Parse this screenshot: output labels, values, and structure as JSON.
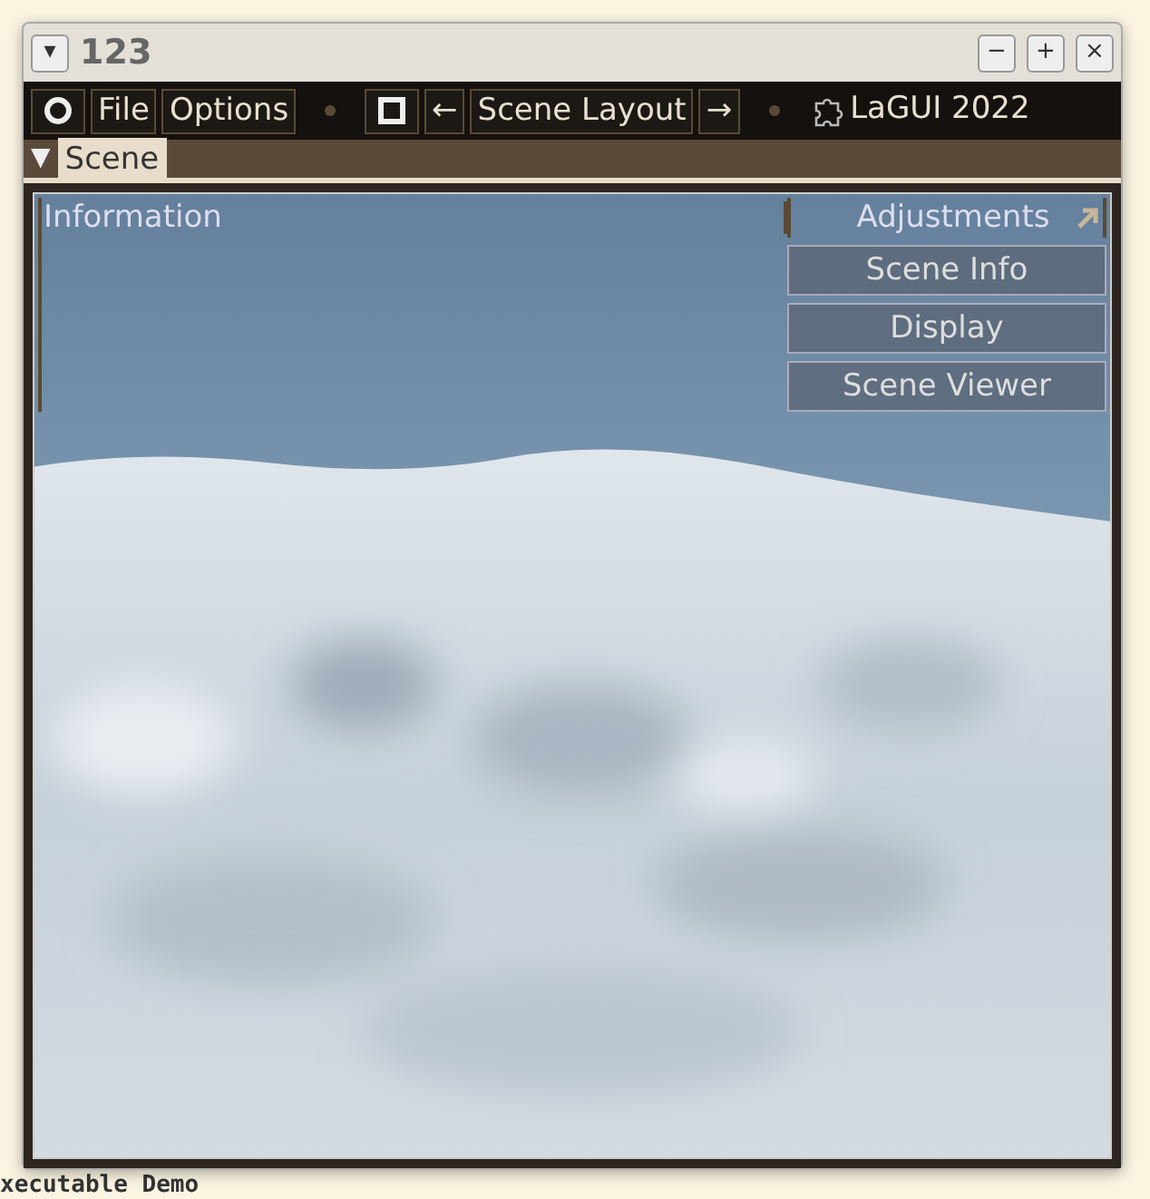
{
  "background_editor": {
    "status": "xecutable Demo"
  },
  "window": {
    "title": "123",
    "menu_glyph": "▾",
    "controls": [
      "−",
      "+",
      "×"
    ]
  },
  "toolbar": {
    "items": [
      {
        "kind": "circle"
      },
      {
        "kind": "text",
        "label": "File"
      },
      {
        "kind": "text",
        "label": "Options"
      },
      {
        "kind": "dot"
      },
      {
        "kind": "square"
      },
      {
        "kind": "text",
        "label": "←"
      },
      {
        "kind": "text",
        "label": "Scene Layout"
      },
      {
        "kind": "text",
        "label": "→"
      },
      {
        "kind": "dot"
      },
      {
        "kind": "brand",
        "label": "LaGUI 2022"
      }
    ]
  },
  "tabs": [
    {
      "caret": "▼",
      "label": "Scene",
      "selected": true
    }
  ],
  "scene": {
    "kind": "picture",
    "left_panel": {
      "title": "Information"
    },
    "right_panel": {
      "title": "Adjustments",
      "buttons": [
        "Scene Info",
        "Display",
        "Scene Viewer"
      ]
    }
  }
}
